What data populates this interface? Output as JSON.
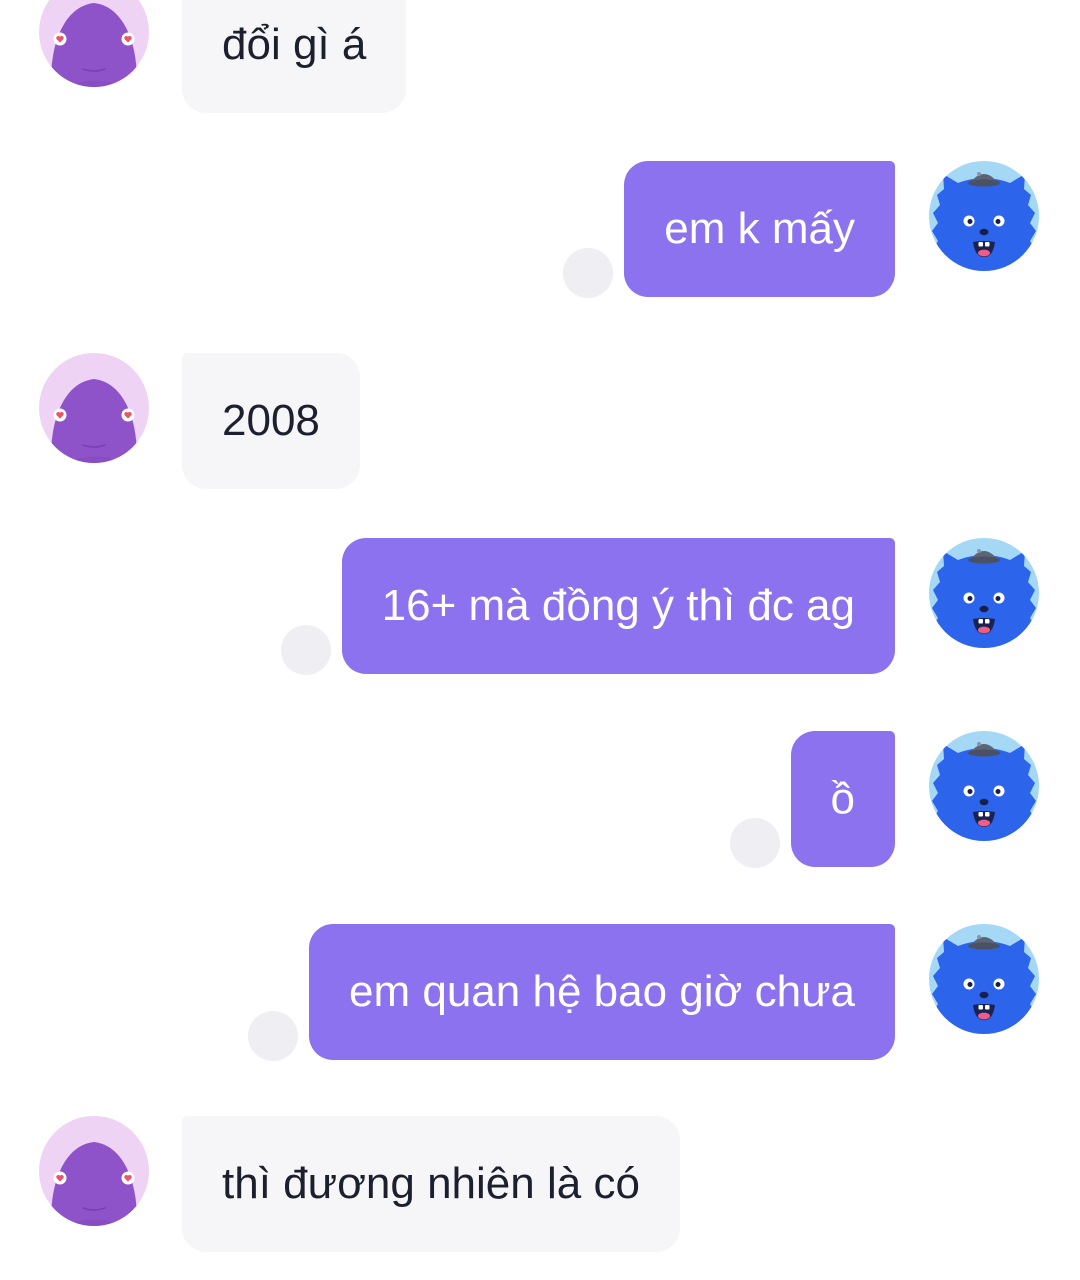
{
  "conversation": {
    "messages": [
      {
        "outgoing": false,
        "text": "đổi gì á"
      },
      {
        "outgoing": true,
        "text": "em k mấy",
        "read": true
      },
      {
        "outgoing": false,
        "text": "2008"
      },
      {
        "outgoing": true,
        "text": "16+ mà đồng ý thì đc ag",
        "read": true
      },
      {
        "outgoing": true,
        "text": "ồ",
        "read": true
      },
      {
        "outgoing": true,
        "text": "em quan hệ bao giờ chưa",
        "read": true
      },
      {
        "outgoing": false,
        "text": "thì đương nhiên là có"
      }
    ]
  },
  "icons": {
    "contact_avatar": "purple-blob-avatar-icon",
    "my_avatar": "blue-monster-avatar-icon",
    "read_receipt": "double-check-icon"
  },
  "colors": {
    "background": "#ffffff",
    "incoming_bubble": "#f6f6f9",
    "incoming_text": "#1c1f2e",
    "outgoing_bubble": "#8c72ee",
    "outgoing_text": "#ffffff",
    "read_receipt": "#8c72ee",
    "read_receipt_bg": "#eeeef3",
    "contact_avatar_bg": "#eed3f5",
    "my_avatar_bg": "#a4d8f5"
  }
}
